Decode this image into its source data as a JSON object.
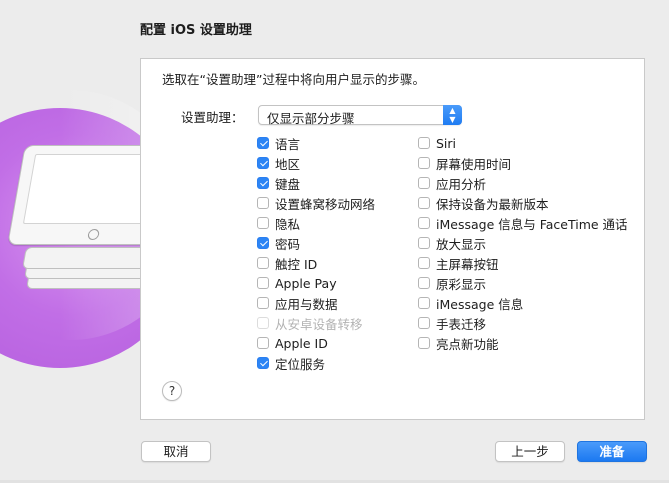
{
  "window": {
    "title": "配置 iOS 设置助理"
  },
  "panel": {
    "description": "选取在“设置助理”过程中将向用户显示的步骤。",
    "select_label": "设置助理：",
    "select_value": "仅显示部分步骤",
    "stepper_up": "▲",
    "stepper_down": "▼",
    "left_items": [
      {
        "label": "语言",
        "checked": true,
        "enabled": true
      },
      {
        "label": "地区",
        "checked": true,
        "enabled": true
      },
      {
        "label": "键盘",
        "checked": true,
        "enabled": true
      },
      {
        "label": "设置蜂窝移动网络",
        "checked": false,
        "enabled": true
      },
      {
        "label": "隐私",
        "checked": false,
        "enabled": true
      },
      {
        "label": "密码",
        "checked": true,
        "enabled": true
      },
      {
        "label": "触控 ID",
        "checked": false,
        "enabled": true
      },
      {
        "label": "Apple Pay",
        "checked": false,
        "enabled": true
      },
      {
        "label": "应用与数据",
        "checked": false,
        "enabled": true
      },
      {
        "label": "从安卓设备转移",
        "checked": false,
        "enabled": false
      },
      {
        "label": "Apple ID",
        "checked": false,
        "enabled": true
      },
      {
        "label": "定位服务",
        "checked": true,
        "enabled": true
      }
    ],
    "right_items": [
      {
        "label": "Siri",
        "checked": false,
        "enabled": true
      },
      {
        "label": "屏幕使用时间",
        "checked": false,
        "enabled": true
      },
      {
        "label": "应用分析",
        "checked": false,
        "enabled": true
      },
      {
        "label": "保持设备为最新版本",
        "checked": false,
        "enabled": true
      },
      {
        "label": "iMessage 信息与 FaceTime 通话",
        "checked": false,
        "enabled": true
      },
      {
        "label": "放大显示",
        "checked": false,
        "enabled": true
      },
      {
        "label": "主屏幕按钮",
        "checked": false,
        "enabled": true
      },
      {
        "label": "原彩显示",
        "checked": false,
        "enabled": true
      },
      {
        "label": "iMessage 信息",
        "checked": false,
        "enabled": true
      },
      {
        "label": "手表迁移",
        "checked": false,
        "enabled": true
      },
      {
        "label": "亮点新功能",
        "checked": false,
        "enabled": true
      }
    ],
    "help_label": "?"
  },
  "footer": {
    "cancel_label": "取消",
    "back_label": "上一步",
    "primary_label": "准备"
  },
  "colors": {
    "accent": "#2d85f5",
    "illustration": "#c16ee6"
  }
}
